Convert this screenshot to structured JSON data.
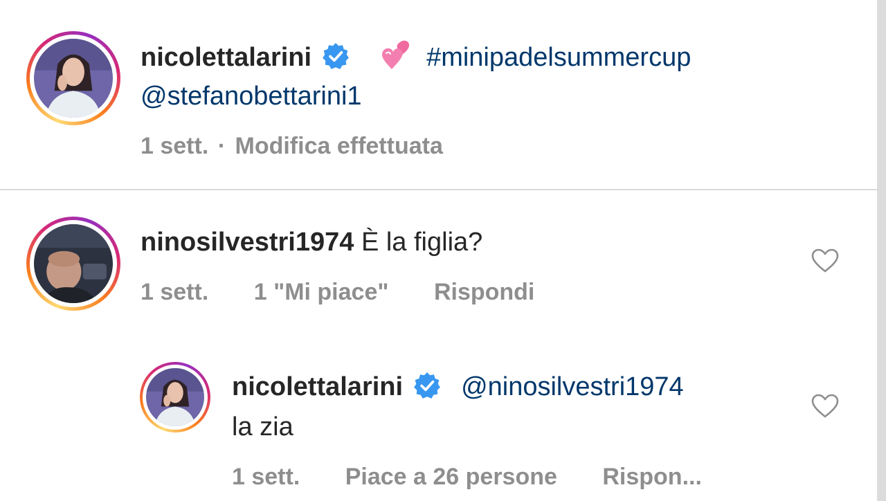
{
  "caption": {
    "username": "nicolettalarini",
    "hashtag": "#minipadelsummercup",
    "mention": "@stefanobettarini1",
    "emoji": "two-hearts-emoji",
    "time": "1 sett.",
    "separator": "·",
    "edited": "Modifica effettuata"
  },
  "comment": {
    "username": "ninosilvestri1974",
    "text": "È la figlia?",
    "time": "1 sett.",
    "likes": "1 \"Mi piace\"",
    "reply": "Rispondi"
  },
  "reply": {
    "username": "nicolettalarini",
    "mention": "@ninosilvestri1974",
    "text": "la zia",
    "time": "1 sett.",
    "likes": "Piace a 26 persone",
    "reply": "Rispon..."
  },
  "colors": {
    "link": "#00376b",
    "meta": "#8e8e8e",
    "verified": "#3897f0",
    "text": "#262626"
  }
}
